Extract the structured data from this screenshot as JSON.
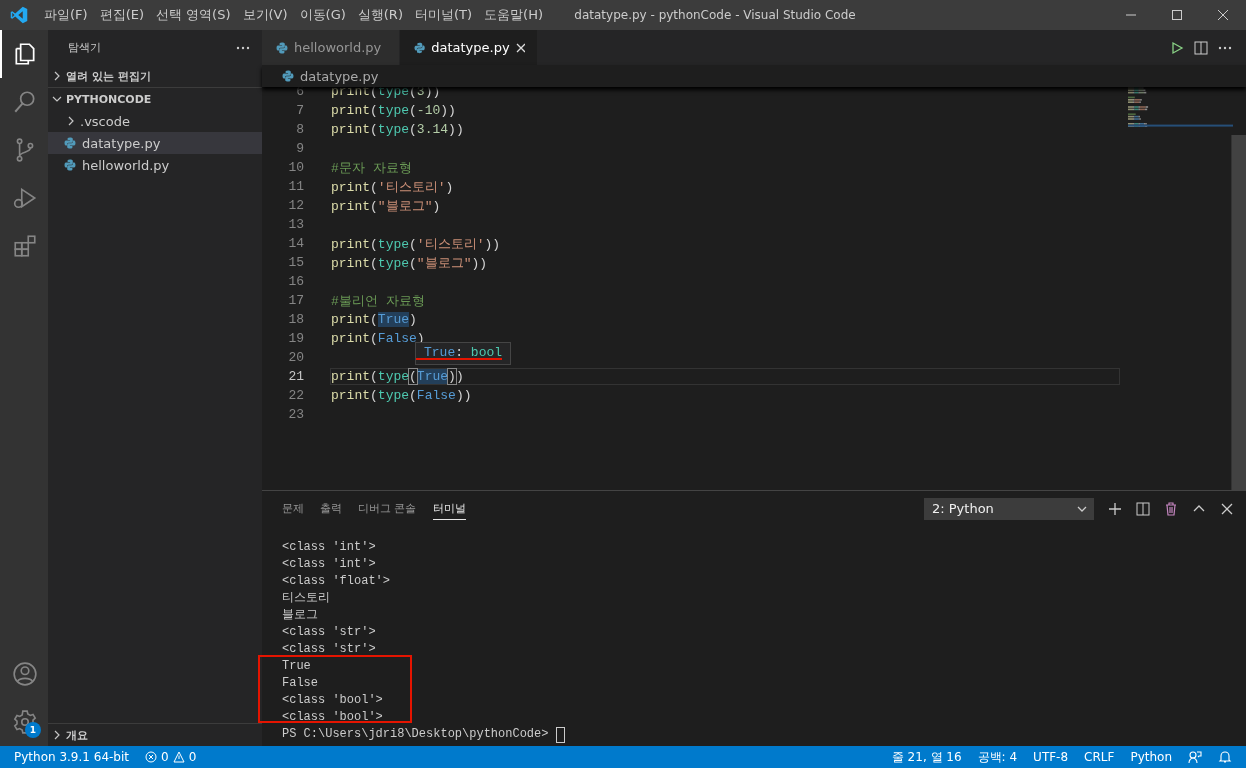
{
  "title_bar": {
    "menu": [
      "파일(F)",
      "편집(E)",
      "선택 영역(S)",
      "보기(V)",
      "이동(G)",
      "실행(R)",
      "터미널(T)",
      "도움말(H)"
    ],
    "title": "datatype.py - pythonCode - Visual Studio Code"
  },
  "activity_bar": {
    "items": [
      {
        "kind": "explorer",
        "selected": true
      },
      {
        "kind": "search",
        "selected": false
      },
      {
        "kind": "source-control",
        "selected": false
      },
      {
        "kind": "debug",
        "selected": false
      },
      {
        "kind": "extensions",
        "selected": false
      }
    ],
    "settings_badge": "1"
  },
  "sidebar": {
    "title": "탐색기",
    "open_editors": {
      "label": "열려 있는 편집기",
      "expanded": false
    },
    "folder": {
      "label": "PYTHONCODE",
      "expanded": true,
      "items": [
        {
          "kind": "folder",
          "label": ".vscode",
          "expanded": false,
          "selected": false
        },
        {
          "kind": "file",
          "label": "datatype.py",
          "selected": true
        },
        {
          "kind": "file",
          "label": "helloworld.py",
          "selected": false
        }
      ]
    },
    "outline": {
      "label": "개요",
      "expanded": false
    }
  },
  "editor": {
    "tabs": [
      {
        "label": "helloworld.py",
        "selected": false
      },
      {
        "label": "datatype.py",
        "selected": true
      }
    ],
    "breadcrumb": "datatype.py",
    "lines": [
      {
        "number": "6",
        "current": false,
        "tokens": [
          {
            "text": "print",
            "kind": "fn"
          },
          {
            "text": "(",
            "kind": "punc"
          },
          {
            "text": "type",
            "kind": "type"
          },
          {
            "text": "(",
            "kind": "punc"
          },
          {
            "text": "3",
            "kind": "num"
          },
          {
            "text": "))",
            "kind": "punc"
          }
        ]
      },
      {
        "number": "7",
        "current": false,
        "tokens": [
          {
            "text": "print",
            "kind": "fn"
          },
          {
            "text": "(",
            "kind": "punc"
          },
          {
            "text": "type",
            "kind": "type"
          },
          {
            "text": "(",
            "kind": "punc"
          },
          {
            "text": "-10",
            "kind": "num"
          },
          {
            "text": "))",
            "kind": "punc"
          }
        ]
      },
      {
        "number": "8",
        "current": false,
        "tokens": [
          {
            "text": "print",
            "kind": "fn"
          },
          {
            "text": "(",
            "kind": "punc"
          },
          {
            "text": "type",
            "kind": "type"
          },
          {
            "text": "(",
            "kind": "punc"
          },
          {
            "text": "3.14",
            "kind": "num"
          },
          {
            "text": "))",
            "kind": "punc"
          }
        ]
      },
      {
        "number": "9",
        "current": false
      },
      {
        "number": "10",
        "current": false,
        "tokens": [
          {
            "text": "#문자 자료형",
            "kind": "comment"
          }
        ]
      },
      {
        "number": "11",
        "current": false,
        "tokens": [
          {
            "text": "print",
            "kind": "fn"
          },
          {
            "text": "(",
            "kind": "punc"
          },
          {
            "text": "'티스토리'",
            "kind": "str"
          },
          {
            "text": ")",
            "kind": "punc"
          }
        ]
      },
      {
        "number": "12",
        "current": false,
        "tokens": [
          {
            "text": "print",
            "kind": "fn"
          },
          {
            "text": "(",
            "kind": "punc"
          },
          {
            "text": "\"블로그\"",
            "kind": "str"
          },
          {
            "text": ")",
            "kind": "punc"
          }
        ]
      },
      {
        "number": "13",
        "current": false
      },
      {
        "number": "14",
        "current": false,
        "tokens": [
          {
            "text": "print",
            "kind": "fn"
          },
          {
            "text": "(",
            "kind": "punc"
          },
          {
            "text": "type",
            "kind": "type"
          },
          {
            "text": "(",
            "kind": "punc"
          },
          {
            "text": "'티스토리'",
            "kind": "str"
          },
          {
            "text": "))",
            "kind": "punc"
          }
        ]
      },
      {
        "number": "15",
        "current": false,
        "tokens": [
          {
            "text": "print",
            "kind": "fn"
          },
          {
            "text": "(",
            "kind": "punc"
          },
          {
            "text": "type",
            "kind": "type"
          },
          {
            "text": "(",
            "kind": "punc"
          },
          {
            "text": "\"블로그\"",
            "kind": "str"
          },
          {
            "text": "))",
            "kind": "punc"
          }
        ]
      },
      {
        "number": "16",
        "current": false
      },
      {
        "number": "17",
        "current": false,
        "tokens": [
          {
            "text": "#불리언 자료형",
            "kind": "comment"
          }
        ]
      },
      {
        "number": "18",
        "current": false,
        "tokens": [
          {
            "text": "print",
            "kind": "fn"
          },
          {
            "text": "(",
            "kind": "punc"
          },
          {
            "text": "True",
            "kind": "const",
            "highlight": true
          },
          {
            "text": ")",
            "kind": "punc"
          }
        ]
      },
      {
        "number": "19",
        "current": false,
        "tokens": [
          {
            "text": "print",
            "kind": "fn"
          },
          {
            "text": "(",
            "kind": "punc"
          },
          {
            "text": "False",
            "kind": "const"
          },
          {
            "text": ")",
            "kind": "punc"
          }
        ]
      },
      {
        "number": "20",
        "current": false
      },
      {
        "number": "21",
        "current": true,
        "tokens": [
          {
            "text": "print",
            "kind": "fn"
          },
          {
            "text": "(",
            "kind": "punc"
          },
          {
            "text": "type",
            "kind": "type"
          },
          {
            "text": "(",
            "kind": "punc",
            "bracket_match": true
          },
          {
            "text": "True",
            "kind": "const",
            "highlight": true
          },
          {
            "text": ")",
            "kind": "punc",
            "bracket_match": true
          },
          {
            "text": ")",
            "kind": "punc"
          }
        ]
      },
      {
        "number": "22",
        "current": false,
        "tokens": [
          {
            "text": "print",
            "kind": "fn"
          },
          {
            "text": "(",
            "kind": "punc"
          },
          {
            "text": "type",
            "kind": "type"
          },
          {
            "text": "(",
            "kind": "punc"
          },
          {
            "text": "False",
            "kind": "const"
          },
          {
            "text": "))",
            "kind": "punc"
          }
        ]
      },
      {
        "number": "23",
        "current": false
      }
    ],
    "hover": [
      {
        "text": "True",
        "kind": "const"
      },
      {
        "text": ": ",
        "kind": "punc"
      },
      {
        "text": "bool",
        "kind": "type"
      }
    ]
  },
  "panel": {
    "tabs": [
      {
        "label": "문제",
        "selected": false
      },
      {
        "label": "출력",
        "selected": false
      },
      {
        "label": "디버그 콘솔",
        "selected": false
      },
      {
        "label": "터미널",
        "selected": true
      }
    ],
    "terminal_select": "2: Python",
    "terminal_lines": [
      "<class 'int'>",
      "<class 'int'>",
      "<class 'float'>",
      "티스토리",
      "블로그",
      "<class 'str'>",
      "<class 'str'>",
      "True",
      "False",
      "<class 'bool'>",
      "<class 'bool'>"
    ],
    "prompt": "PS C:\\Users\\jdri8\\Desktop\\pythonCode>"
  },
  "status_bar": {
    "interpreter": "Python 3.9.1 64-bit",
    "errors": "0",
    "warnings": "0",
    "position": "줄 21, 열 16",
    "indent": "공백: 4",
    "encoding": "UTF-8",
    "line_ending": "CRLF",
    "language": "Python"
  }
}
